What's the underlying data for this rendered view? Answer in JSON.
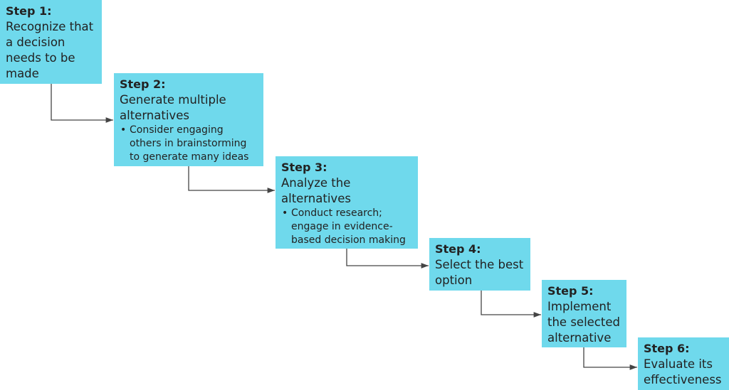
{
  "colors": {
    "box_fill": "#6fd9ec",
    "connector": "#444444"
  },
  "steps": [
    {
      "label": "Step 1:",
      "text": "Recognize that a decision needs to be made",
      "bullets": []
    },
    {
      "label": "Step 2:",
      "text": "Generate multiple alternatives",
      "bullets": [
        "Consider engaging others in  brainstorming to generate many ideas"
      ]
    },
    {
      "label": "Step 3:",
      "text": "Analyze the alternatives",
      "bullets": [
        "Conduct research; engage in evidence-based decision making"
      ]
    },
    {
      "label": "Step 4:",
      "text": "Select the best option",
      "bullets": []
    },
    {
      "label": "Step 5:",
      "text": "Implement the selected alternative",
      "bullets": []
    },
    {
      "label": "Step 6:",
      "text": "Evaluate its effectiveness",
      "bullets": []
    }
  ]
}
